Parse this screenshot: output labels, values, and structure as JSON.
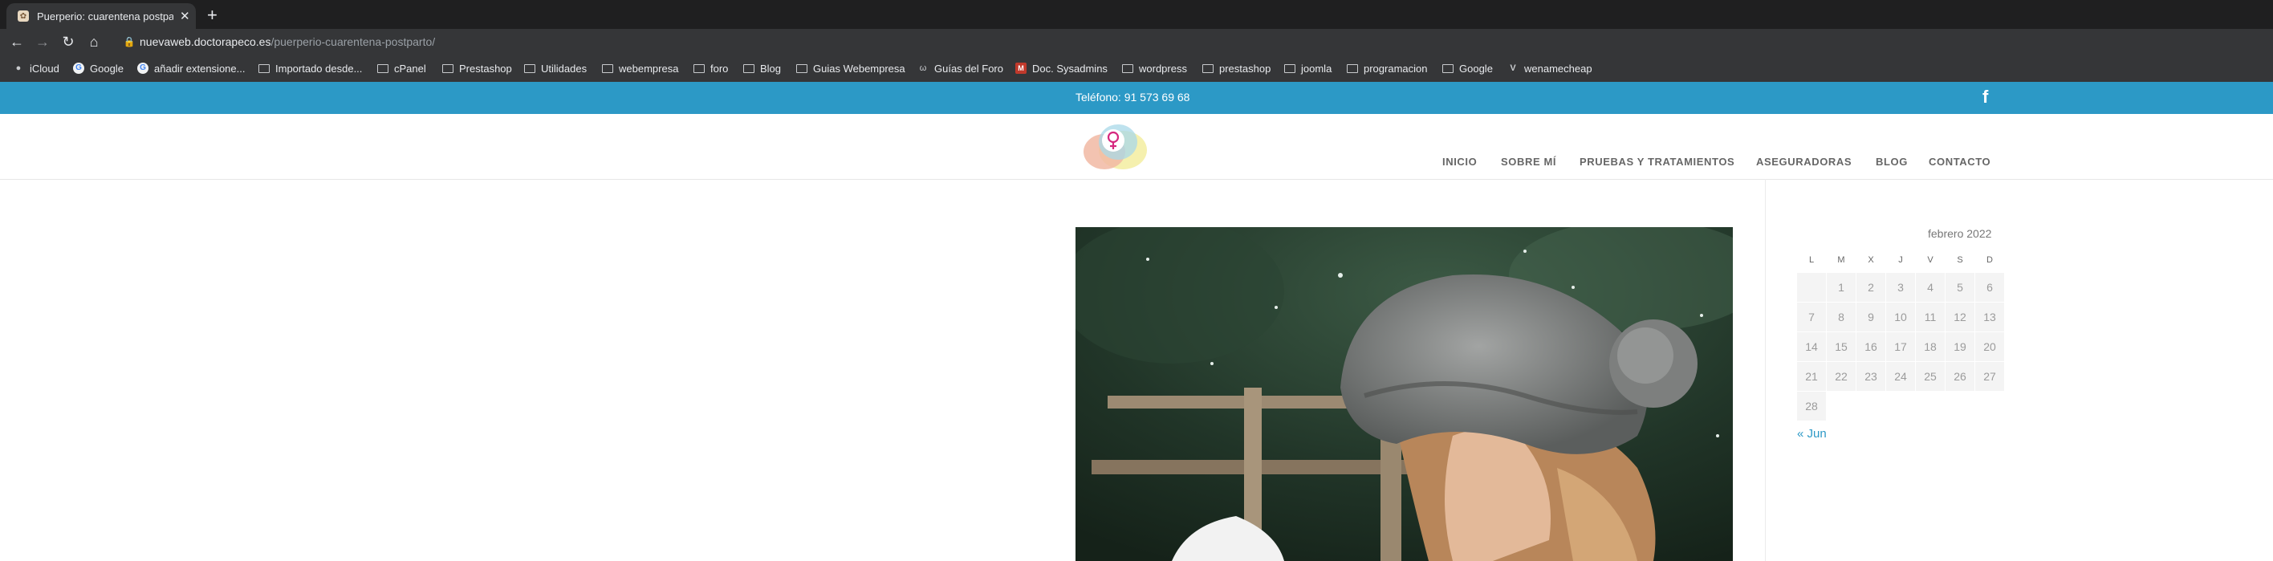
{
  "browser": {
    "tab_title": "Puerperio: cuarentena postparto",
    "url_host": "nuevaweb.doctorapeco.es",
    "url_path": "/puerperio-cuarentena-postparto/",
    "bookmarks": [
      {
        "label": "iCloud",
        "icon": "apple-icon"
      },
      {
        "label": "Google",
        "icon": "google-icon"
      },
      {
        "label": "añadir extensione...",
        "icon": "google-icon"
      },
      {
        "label": "Importado desde...",
        "icon": "folder-icon"
      },
      {
        "label": "cPanel",
        "icon": "folder-icon"
      },
      {
        "label": "Prestashop",
        "icon": "folder-icon"
      },
      {
        "label": "Utilidades",
        "icon": "folder-icon"
      },
      {
        "label": "webempresa",
        "icon": "folder-icon"
      },
      {
        "label": "foro",
        "icon": "folder-icon"
      },
      {
        "label": "Blog",
        "icon": "folder-icon"
      },
      {
        "label": "Guias Webempresa",
        "icon": "folder-icon"
      },
      {
        "label": "Guías del Foro",
        "icon": "w-icon"
      },
      {
        "label": "Doc. Sysadmins",
        "icon": "m-icon"
      },
      {
        "label": "wordpress",
        "icon": "folder-icon"
      },
      {
        "label": "prestashop",
        "icon": "folder-icon"
      },
      {
        "label": "joomla",
        "icon": "folder-icon"
      },
      {
        "label": "programacion",
        "icon": "folder-icon"
      },
      {
        "label": "Google",
        "icon": "folder-icon"
      },
      {
        "label": "wenamecheap",
        "icon": "v-icon"
      }
    ]
  },
  "site": {
    "phone": "Teléfono: 91 573 69 68",
    "menu": [
      "INICIO",
      "SOBRE MÍ",
      "PRUEBAS Y TRATAMIENTOS",
      "ASEGURADORAS",
      "BLOG",
      "CONTACTO"
    ],
    "calendar": {
      "caption": "febrero 2022",
      "day_headers": [
        "L",
        "M",
        "X",
        "J",
        "V",
        "S",
        "D"
      ],
      "weeks": [
        [
          "1",
          "2",
          "3",
          "4",
          "5",
          "6"
        ],
        [
          "7",
          "8",
          "9",
          "10",
          "11",
          "12",
          "13"
        ],
        [
          "14",
          "15",
          "16",
          "17",
          "18",
          "19",
          "20"
        ],
        [
          "21",
          "22",
          "23",
          "24",
          "25",
          "26",
          "27"
        ],
        [
          "28"
        ]
      ],
      "prev_link": "« Jun"
    }
  },
  "colors": {
    "topbar": "#2c99c6",
    "chrome_dark": "#1f1f20",
    "chrome_toolbar": "#353638"
  }
}
